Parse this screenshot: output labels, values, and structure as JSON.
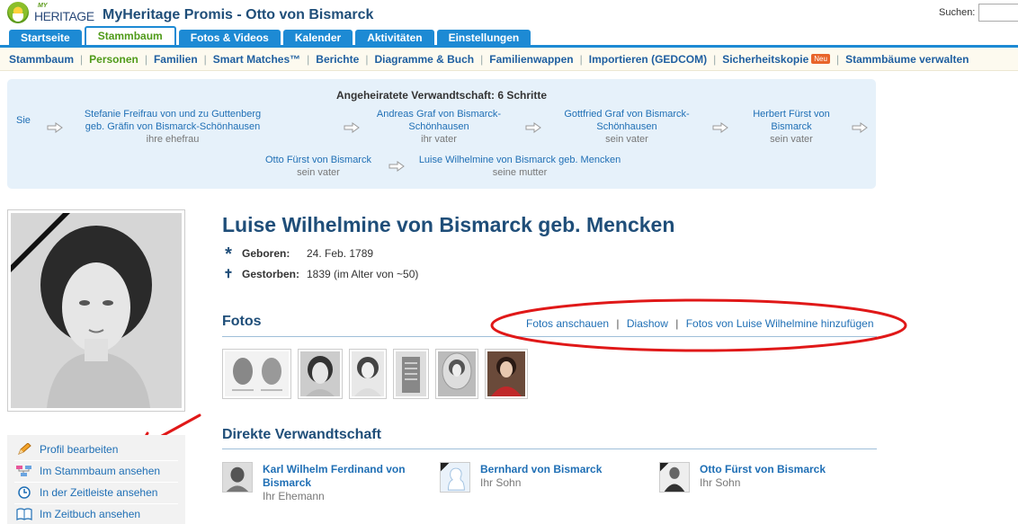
{
  "header": {
    "logo_my": "MY",
    "logo_text": "HERITAGE",
    "site_title": "MyHeritage Promis - Otto von Bismarck",
    "search_label": "Suchen:"
  },
  "tabs": [
    {
      "label": "Startseite"
    },
    {
      "label": "Stammbaum",
      "active": true
    },
    {
      "label": "Fotos & Videos"
    },
    {
      "label": "Kalender"
    },
    {
      "label": "Aktivitäten"
    },
    {
      "label": "Einstellungen"
    }
  ],
  "subnav": {
    "items": [
      {
        "label": "Stammbaum"
      },
      {
        "label": "Personen",
        "active": true
      },
      {
        "label": "Familien"
      },
      {
        "label": "Smart Matches™"
      },
      {
        "label": "Berichte"
      },
      {
        "label": "Diagramme & Buch"
      },
      {
        "label": "Familienwappen"
      },
      {
        "label": "Importieren (GEDCOM)"
      },
      {
        "label": "Sicherheitskopie",
        "badge": "Neu"
      },
      {
        "label": "Stammbäume verwalten"
      }
    ]
  },
  "relationship": {
    "title": "Angeheiratete Verwandtschaft: 6 Schritte",
    "start": "Sie",
    "steps": [
      {
        "name": "Stefanie Freifrau von und zu Guttenberg geb. Gräfin von Bismarck-Schönhausen",
        "role": "ihre ehefrau"
      },
      {
        "name": "Andreas Graf von Bismarck-Schönhausen",
        "role": "ihr vater"
      },
      {
        "name": "Gottfried Graf von Bismarck-Schönhausen",
        "role": "sein vater"
      },
      {
        "name": "Herbert Fürst von Bismarck",
        "role": "sein vater"
      },
      {
        "name": "Otto Fürst von Bismarck",
        "role": "sein vater"
      },
      {
        "name": "Luise Wilhelmine von Bismarck geb. Mencken",
        "role": "seine mutter"
      }
    ]
  },
  "profile": {
    "name": "Luise Wilhelmine von Bismarck geb. Mencken",
    "born_label": "Geboren:",
    "born_value": "24. Feb. 1789",
    "died_label": "Gestorben:",
    "died_value": "1839 (im Alter von ~50)"
  },
  "photos": {
    "title": "Fotos",
    "links": [
      "Fotos anschauen",
      "Diashow",
      "Fotos von Luise Wilhelmine hinzufügen"
    ],
    "link_separator": "|"
  },
  "actions": [
    {
      "label": "Profil bearbeiten",
      "icon": "pencil-icon"
    },
    {
      "label": "Im Stammbaum ansehen",
      "icon": "tree-icon"
    },
    {
      "label": "In der Zeitleiste ansehen",
      "icon": "timeline-icon"
    },
    {
      "label": "Im Zeitbuch ansehen",
      "icon": "book-icon"
    }
  ],
  "relatives": {
    "title": "Direkte Verwandtschaft",
    "items": [
      {
        "name": "Karl Wilhelm Ferdinand von Bismarck",
        "relation": "Ihr Ehemann"
      },
      {
        "name": "Bernhard von Bismarck",
        "relation": "Ihr Sohn"
      },
      {
        "name": "Otto Fürst von Bismarck",
        "relation": "Ihr Sohn"
      }
    ]
  },
  "colors": {
    "brand_blue": "#1d8ad4",
    "title_blue": "#1f4e79",
    "link_blue": "#1f6fb5",
    "active_green": "#4f9a19",
    "annotation_red": "#e01818"
  }
}
